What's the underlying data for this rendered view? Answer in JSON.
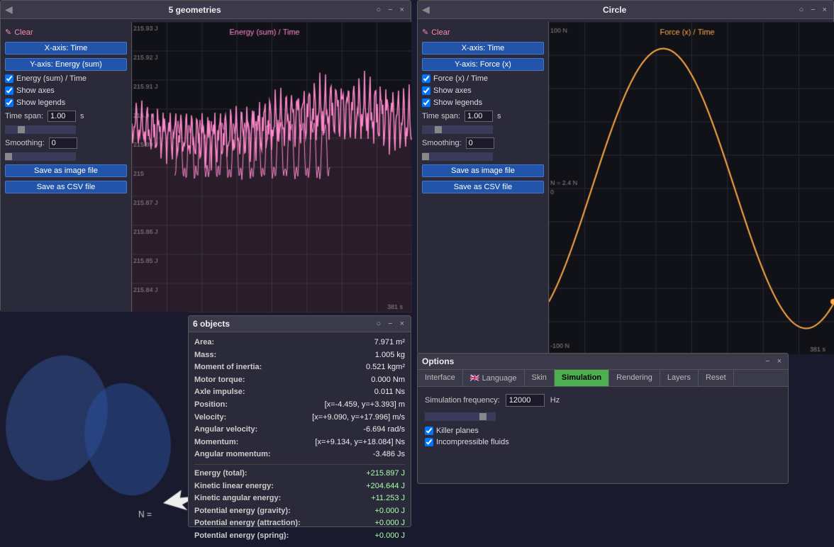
{
  "geometries_panel": {
    "title": "5 geometries",
    "window_controls": [
      "○",
      "−",
      "×"
    ],
    "clear_label": "Clear",
    "x_axis_label": "X-axis: Time",
    "y_axis_label": "Y-axis: Energy (sum)",
    "chart_title": "Energy (sum) / Time",
    "checkbox_chart": "Energy (sum) / Time",
    "checkbox_axes": "Show axes",
    "checkbox_legends": "Show legends",
    "timespan_label": "Time span:",
    "timespan_value": "1.00",
    "timespan_unit": "s",
    "smoothing_label": "Smoothing:",
    "smoothing_value": "0",
    "save_image_label": "Save as image file",
    "save_csv_label": "Save as CSV file",
    "chart_y_max": "215.93 J",
    "chart_y2": "215.92 J",
    "chart_y3": "215.91 J",
    "chart_y4": "215.9 J",
    "chart_y5": "215.89 J",
    "chart_y6": "215",
    "chart_y7": "215.87 J",
    "chart_y8": "215.86 J",
    "chart_y9": "215.85 J",
    "chart_y10": "215.84 J",
    "chart_x_max": "381 s"
  },
  "circle_panel": {
    "title": "Circle",
    "window_controls": [
      "○",
      "−",
      "×"
    ],
    "clear_label": "Clear",
    "x_axis_label": "X-axis: Time",
    "y_axis_label": "Y-axis: Force (x)",
    "chart_title": "Force (x) / Time",
    "checkbox_chart": "Force (x) / Time",
    "checkbox_axes": "Show axes",
    "checkbox_legends": "Show legends",
    "timespan_label": "Time span:",
    "timespan_value": "1.00",
    "timespan_unit": "s",
    "smoothing_label": "Smoothing:",
    "smoothing_value": "0",
    "save_image_label": "Save as image file",
    "save_csv_label": "Save as CSV file",
    "chart_y_top": "100 N",
    "chart_y_mid": "N = 2.4 N",
    "chart_y_zero": "0",
    "chart_y_bottom": "-100 N",
    "chart_x_max": "381 s"
  },
  "objects_panel": {
    "title": "6 objects",
    "window_controls": [
      "○",
      "−",
      "×"
    ],
    "rows": [
      {
        "label": "Area:",
        "value": "7.971 m²"
      },
      {
        "label": "Mass:",
        "value": "1.005 kg"
      },
      {
        "label": "Moment of inertia:",
        "value": "0.521 kgm²"
      },
      {
        "label": "Motor torque:",
        "value": "0.000 Nm"
      },
      {
        "label": "Axle impulse:",
        "value": "0.011 Ns"
      },
      {
        "label": "Position:",
        "value": "[x=-4.459, y=+3.393] m"
      },
      {
        "label": "Velocity:",
        "value": "[x=+9.090, y=+17.996] m/s"
      },
      {
        "label": "Angular velocity:",
        "value": "-6.694 rad/s"
      },
      {
        "label": "Momentum:",
        "value": "[x=+9.134, y=+18.084] Ns"
      },
      {
        "label": "Angular momentum:",
        "value": "-3.486 Js"
      }
    ],
    "energy_rows": [
      {
        "label": "Energy (total):",
        "value": "+215.897 J"
      },
      {
        "label": "Kinetic linear energy:",
        "value": "+204.644 J"
      },
      {
        "label": "Kinetic angular energy:",
        "value": "+11.253 J"
      },
      {
        "label": "Potential energy (gravity):",
        "value": "+0.000 J"
      },
      {
        "label": "Potential energy (attraction):",
        "value": "+0.000 J"
      },
      {
        "label": "Potential energy (spring):",
        "value": "+0.000 J"
      }
    ]
  },
  "options_panel": {
    "title": "Options",
    "window_controls": [
      "−",
      "×"
    ],
    "tabs": [
      {
        "label": "Interface",
        "active": false
      },
      {
        "label": "🇬🇧 Language",
        "active": false
      },
      {
        "label": "Skin",
        "active": false
      },
      {
        "label": "Simulation",
        "active": true
      },
      {
        "label": "Rendering",
        "active": false
      },
      {
        "label": "Layers",
        "active": false
      },
      {
        "label": "Reset",
        "active": false
      }
    ],
    "sim_freq_label": "Simulation frequency:",
    "sim_freq_value": "12000",
    "sim_freq_unit": "Hz",
    "killer_planes_label": "Killer planes",
    "killer_planes_checked": true,
    "incompressible_label": "Incompressible fluids",
    "incompressible_checked": true
  }
}
